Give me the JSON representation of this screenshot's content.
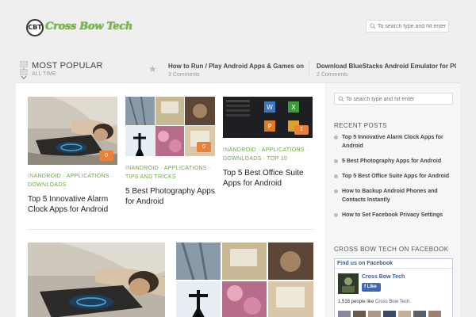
{
  "header": {
    "logo_badge": "CBT",
    "logo_text": "Cross Bow Tech",
    "search_placeholder": "To search type and hit enter"
  },
  "popular": {
    "title": "MOST POPULAR",
    "subtitle": "ALL TIME",
    "items": [
      {
        "title": "How to Run / Play Android Apps & Games on PC",
        "comments": "3 Comments"
      },
      {
        "title": "Download BlueStacks Android Emulator for PC (",
        "comments": "2 Comments"
      }
    ]
  },
  "posts": [
    {
      "cat_first": "IN",
      "cats": "ANDROID · APPLICATIONS · DOWNLOADS",
      "title": "Top 5 Innovative Alarm Clock Apps for Android",
      "badge": "0"
    },
    {
      "cat_first": "IN",
      "cats": "ANDROID · APPLICATIONS · TIPS AND TRICKS",
      "title": "5 Best Photography Apps for Android",
      "badge": "0"
    },
    {
      "cat_first": "IN",
      "cats": "ANDROID · APPLICATIONS · DOWNLOADS · TOP 10",
      "title": "Top 5 Best Office Suite Apps for Android",
      "badge": "1"
    }
  ],
  "sidebar": {
    "search_placeholder": "To search type and hit enter",
    "recent_heading": "RECENT POSTS",
    "recent_posts": [
      "Top 5 Innovative Alarm Clock Apps for Android",
      "5 Best Photography Apps for Android",
      "Top 5 Best Office Suite Apps for Android",
      "How to Backup Android Phones and Contacts Instantly",
      "How to Set Facebook Privacy Settings"
    ],
    "fb_heading": "CROSS BOW TECH ON FACEBOOK",
    "fb": {
      "find_us": "Find us on Facebook",
      "page_name": "Cross Bow Tech",
      "like": "Like",
      "count_text": "1,518 people like",
      "count_link": "Cross Bow Tech."
    }
  },
  "colors": {
    "accent_green": "#6aa83f",
    "facebook_blue": "#3b5998",
    "badge_orange": "#e8823a"
  }
}
